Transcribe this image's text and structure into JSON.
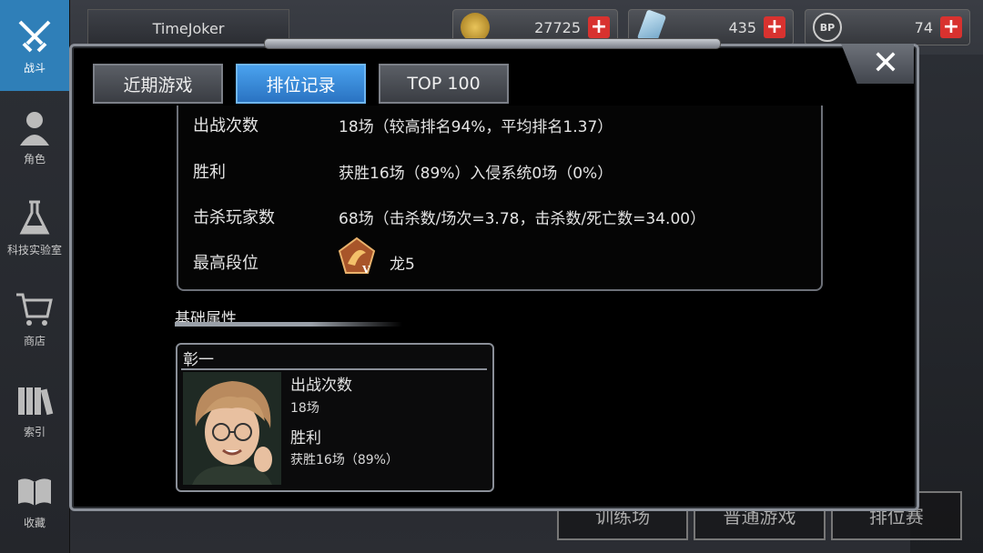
{
  "nav": {
    "items": [
      {
        "label": "战斗",
        "icon": "swords-icon"
      },
      {
        "label": "角色",
        "icon": "character-icon"
      },
      {
        "label": "科技实验室",
        "icon": "flask-icon"
      },
      {
        "label": "商店",
        "icon": "cart-icon"
      },
      {
        "label": "索引",
        "icon": "books-icon"
      },
      {
        "label": "收藏",
        "icon": "open-book-icon"
      }
    ]
  },
  "player": {
    "name": "TimeJoker"
  },
  "currencies": [
    {
      "icon": "gold-coin-icon",
      "value": "27725"
    },
    {
      "icon": "crystal-icon",
      "value": "435"
    },
    {
      "icon": "bp-paw-icon",
      "value": "74"
    }
  ],
  "modes": [
    "训练场",
    "普通游戏",
    "排位赛"
  ],
  "tabs": [
    {
      "label": "近期游戏",
      "active": false
    },
    {
      "label": "排位记录",
      "active": true
    },
    {
      "label": "TOP 100",
      "active": false
    }
  ],
  "stats": {
    "matches_label": "出战次数",
    "matches_value": "18场（较高排名94%，平均排名1.37）",
    "wins_label": "胜利",
    "wins_value": "获胜16场（89%）入侵系统0场（0%）",
    "kills_label": "击杀玩家数",
    "kills_value": "68场（击杀数/场次=3.78，击杀数/死亡数=34.00）",
    "rank_label": "最高段位",
    "rank_value": "龙5",
    "rank_badge_icon": "dragon-rank-badge-icon",
    "rank_badge_tier": "V"
  },
  "attributes": {
    "title": "基础属性",
    "character": {
      "name": "彰一",
      "matches_label": "出战次数",
      "matches_value": "18场",
      "wins_label": "胜利",
      "wins_value": "获胜16场（89%）"
    }
  },
  "colors": {
    "active_tab": "#2a73c2",
    "nav_active": "#2f7fb8",
    "plus_button": "#d8322f"
  }
}
